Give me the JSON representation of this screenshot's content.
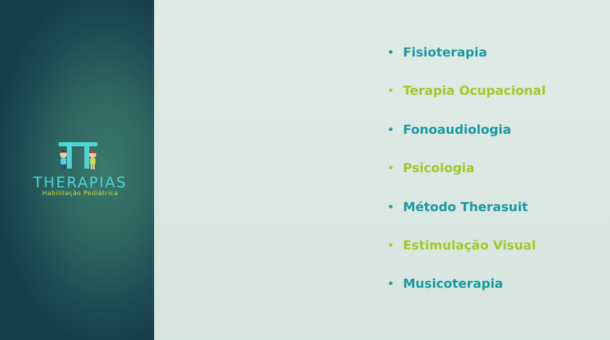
{
  "brand": {
    "name": "THERAPIAS",
    "tagline": "Habilitação Pediátrica",
    "colors": {
      "primary_teal": "#1a9a9e",
      "accent_lime": "#9ccb26",
      "logo_cyan": "#4fd4d8",
      "sidebar_dark": "#1c4a52"
    }
  },
  "services": [
    {
      "label": "Fisioterapia",
      "color": "teal"
    },
    {
      "label": "Terapia Ocupacional",
      "color": "lime"
    },
    {
      "label": "Fonoaudiologia",
      "color": "teal"
    },
    {
      "label": "Psicologia",
      "color": "lime"
    },
    {
      "label": "Método Therasuit",
      "color": "teal"
    },
    {
      "label": "Estimulação Visual",
      "color": "lime"
    },
    {
      "label": "Musicoterapia",
      "color": "teal"
    }
  ],
  "bullet_symbol": "•"
}
